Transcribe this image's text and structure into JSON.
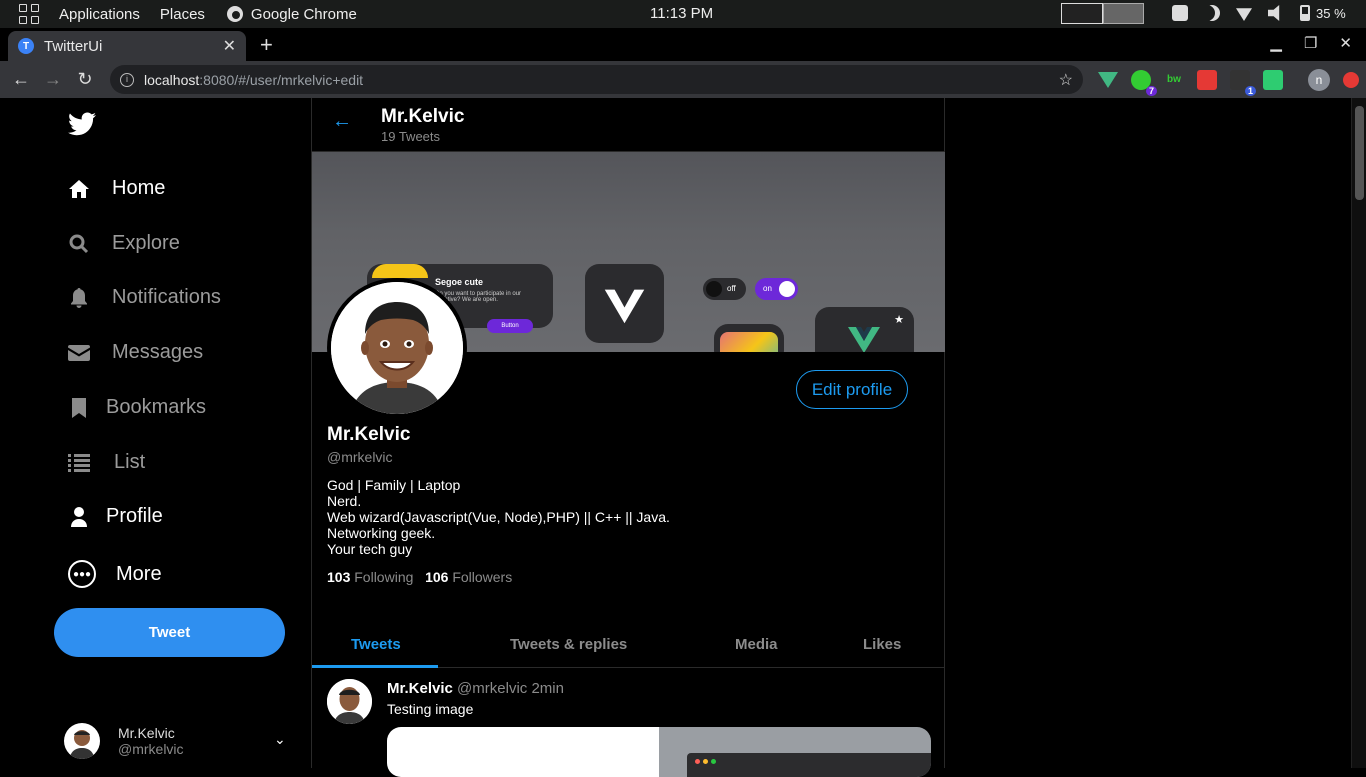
{
  "system": {
    "applications": "Applications",
    "places": "Places",
    "active_app": "Google Chrome",
    "clock": "11:13 PM",
    "battery": "35 %"
  },
  "browser": {
    "tab_title": "TwitterUi",
    "tab_favicon": "T",
    "url_host": "localhost",
    "url_path": ":8080/#/user/mrkelvic+edit",
    "profile_initial": "n",
    "ext_badges": [
      "7",
      "1"
    ]
  },
  "sidebar": {
    "items": [
      {
        "label": "Home",
        "icon": "home-icon"
      },
      {
        "label": "Explore",
        "icon": "search-icon"
      },
      {
        "label": "Notifications",
        "icon": "bell-icon"
      },
      {
        "label": "Messages",
        "icon": "mail-icon"
      },
      {
        "label": "Bookmarks",
        "icon": "bookmark-icon"
      },
      {
        "label": "List",
        "icon": "list-icon"
      },
      {
        "label": "Profile",
        "icon": "user-icon"
      },
      {
        "label": "More",
        "icon": "more-icon"
      }
    ],
    "tweet_button": "Tweet",
    "account": {
      "name": "Mr.Kelvic",
      "handle": "@mrkelvic"
    }
  },
  "profile": {
    "header_name": "Mr.Kelvic",
    "tweet_count": "19 Tweets",
    "edit_button": "Edit profile",
    "name": "Mr.Kelvic",
    "handle": "@mrkelvic",
    "bio": [
      "God | Family | Laptop",
      "Nerd.",
      "Web wizard(Javascript(Vue, Node),PHP) || C++ || Java.",
      "Networking geek.",
      "Your tech guy"
    ],
    "following_count": "103",
    "following_label": "Following",
    "followers_count": "106",
    "followers_label": "Followers",
    "banner": {
      "card_title": "Segoe cute",
      "card_text": "Do you want to participate in our Initiative? We are open.",
      "card_button": "Button",
      "toggle_off": "off",
      "toggle_on": "on"
    }
  },
  "tabs": [
    "Tweets",
    "Tweets & replies",
    "Media",
    "Likes"
  ],
  "tweet": {
    "name": "Mr.Kelvic",
    "handle": "@mrkelvic",
    "time": "2min",
    "text": "Testing image"
  },
  "colors": {
    "accent": "#1d9bf0",
    "background": "#000000",
    "muted": "#8b8b8b"
  }
}
